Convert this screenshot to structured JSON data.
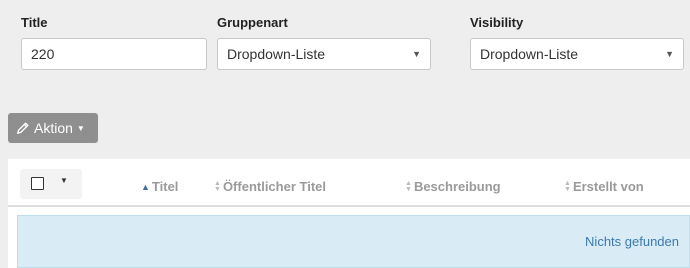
{
  "filters": {
    "title": {
      "label": "Title",
      "value": "220"
    },
    "gruppenart": {
      "label": "Gruppenart",
      "value": "Dropdown-Liste"
    },
    "visibility": {
      "label": "Visibility",
      "value": "Dropdown-Liste"
    }
  },
  "toolbar": {
    "action_label": "Aktion",
    "action_icon": "pencil-icon"
  },
  "table": {
    "columns": [
      "Titel",
      "Öffentlicher Titel",
      "Beschreibung",
      "Erstellt von"
    ],
    "sorted_column": "Titel",
    "sort_direction": "asc",
    "empty_message": "Nichts gefunden"
  },
  "colors": {
    "page_bg": "#eeeeee",
    "button_bg": "#8f8f8f",
    "empty_bg": "#d9ecf5",
    "empty_text": "#3a7ab0",
    "sort_active": "#3a6ea5"
  }
}
